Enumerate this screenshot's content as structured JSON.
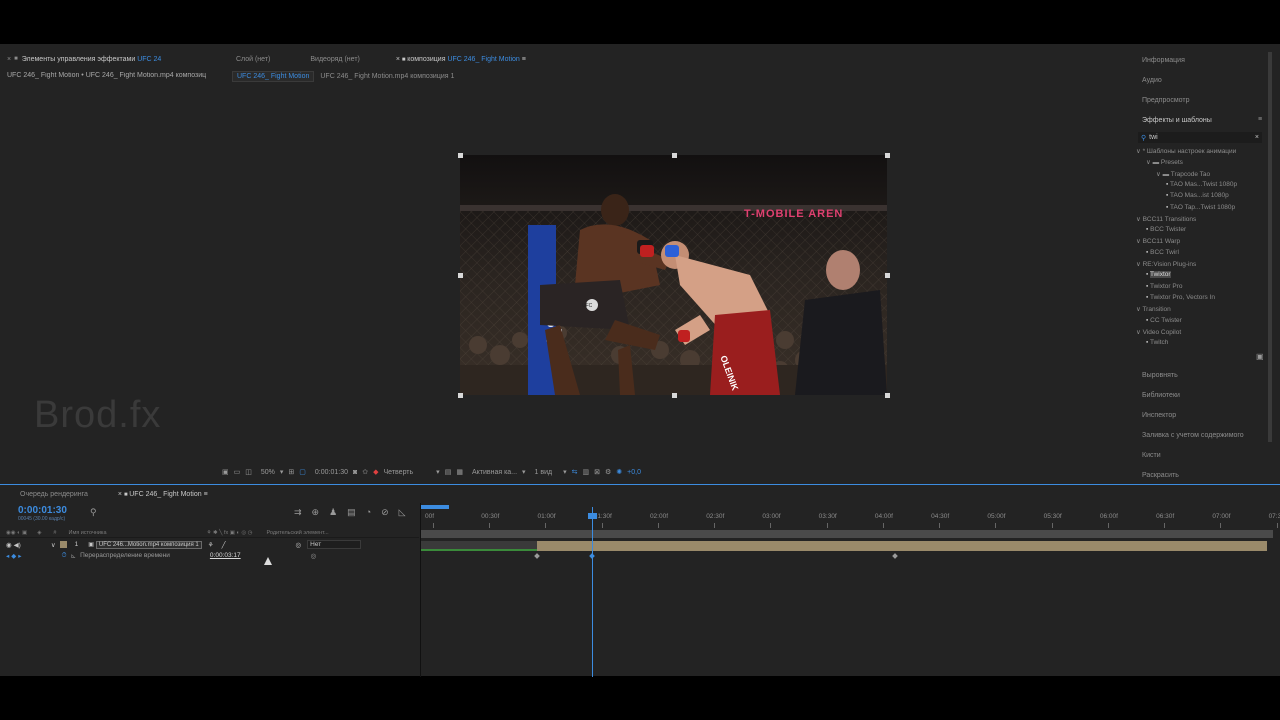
{
  "project_panel": {
    "tab_label": "Элементы управления эффектами",
    "tab_comp": "UFC 24",
    "header": "UFC 246_ Fight Motion • UFC 246_ Fight Motion.mp4 композиц"
  },
  "viewer": {
    "tabs": [
      "Слой (нет)",
      "Видеоряд (нет)",
      "композиция",
      "UFC 246_ Fight Motion"
    ],
    "breadcrumbs": [
      "UFC 246_ Fight Motion",
      "UFC 246_ Fight Motion.mp4 композиция 1"
    ],
    "watermark": "Brod.fx",
    "video_text": {
      "arena_banner": "T-MOBILE AREN",
      "shorts": "OLEINIK",
      "glove_logo": "UFC",
      "pole_text": "ESP"
    },
    "toolbar": {
      "zoom": "50%",
      "time": "0:00:01:30",
      "resolution": "Четверть",
      "camera": "Активная ка...",
      "views": "1 вид",
      "exposure": "+0,0"
    }
  },
  "right_panel": {
    "sections_top": [
      "Информация",
      "Аудио",
      "Предпросмотр"
    ],
    "effects_title": "Эффекты и шаблоны",
    "search_value": "twi",
    "tree": [
      {
        "label": "* Шаблоны настроек анимации",
        "indent": 0,
        "type": "group"
      },
      {
        "label": "Presets",
        "indent": 1,
        "type": "folder"
      },
      {
        "label": "Trapcode Tao",
        "indent": 2,
        "type": "folder"
      },
      {
        "label": "TAO Mas...Twist 1080p",
        "indent": 3,
        "type": "file"
      },
      {
        "label": "TAO Mas...ist 1080p",
        "indent": 3,
        "type": "file"
      },
      {
        "label": "TAO Tap...Twist 1080p",
        "indent": 3,
        "type": "file"
      },
      {
        "label": "BCC11 Transitions",
        "indent": 0,
        "type": "group"
      },
      {
        "label": "BCC Twister",
        "indent": 1,
        "type": "file"
      },
      {
        "label": "BCC11 Warp",
        "indent": 0,
        "type": "group"
      },
      {
        "label": "BCC Twirl",
        "indent": 1,
        "type": "file"
      },
      {
        "label": "RE:Vision Plug-ins",
        "indent": 0,
        "type": "group"
      },
      {
        "label": "Twixtor",
        "indent": 1,
        "type": "file",
        "selected": true
      },
      {
        "label": "Twixtor Pro",
        "indent": 1,
        "type": "file"
      },
      {
        "label": "Twixtor Pro, Vectors In",
        "indent": 1,
        "type": "file"
      },
      {
        "label": "Transition",
        "indent": 0,
        "type": "group"
      },
      {
        "label": "CC Twister",
        "indent": 1,
        "type": "file"
      },
      {
        "label": "Video Copilot",
        "indent": 0,
        "type": "group"
      },
      {
        "label": "Twitch",
        "indent": 1,
        "type": "file"
      }
    ],
    "sections_bottom": [
      "Выровнять",
      "Библиотеки",
      "Инспектор",
      "Заливка с учетом содержимого",
      "Кисти",
      "Раскрасить"
    ]
  },
  "timeline": {
    "tab_render": "Очередь рендеринга",
    "tab_comp": "UFC 246_ Fight Motion",
    "current_time": "0:00:01:30",
    "frame_info": "00045 (30.00 кадр/с)",
    "col_source": "Имя источника",
    "col_parent": "Родительский элемент...",
    "layer_num": "1",
    "layer_name": "UFC 246...Motion.mp4 композиция 1",
    "layer_parent": "Нет",
    "prop_name": "Перераспределение времени",
    "prop_value": "0:00:03:17",
    "ruler": [
      "00f",
      "00:30f",
      "01:00f",
      "01:30f",
      "02:00f",
      "02:30f",
      "03:00f",
      "03:30f",
      "04:00f",
      "04:30f",
      "05:00f",
      "05:30f",
      "06:00f",
      "06:30f",
      "07:00f",
      "07:30"
    ]
  },
  "colors": {
    "accent_blue": "#3c8ce0",
    "layer_bar": "#9a8a6a",
    "bg": "#232323"
  }
}
